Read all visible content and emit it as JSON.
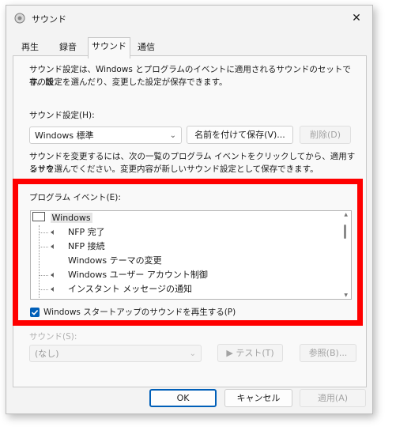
{
  "window": {
    "title": "サウンド",
    "close_symbol": "✕"
  },
  "tabs": [
    {
      "label": "再生"
    },
    {
      "label": "録音"
    },
    {
      "label": "サウンド"
    },
    {
      "label": "通信"
    }
  ],
  "intro_text_line1": "サウンド設定は、Windows とプログラムのイベントに適用されるサウンドのセットです。既",
  "intro_text_line2": "存の設定を選んだり、変更した設定が保存できます。",
  "scheme": {
    "label": "サウンド設定(H):",
    "selected": "Windows 標準",
    "save_as_label": "名前を付けて保存(V)...",
    "delete_label": "削除(D)"
  },
  "instructions_line1": "サウンドを変更するには、次の一覧のプログラム イベントをクリックしてから、適用するサウ",
  "instructions_line2": "ンドを選んでください。変更内容が新しいサウンド設定として保存できます。",
  "events": {
    "label": "プログラム イベント(E):",
    "root": "Windows",
    "items": [
      {
        "label": "NFP 完了",
        "has_sound": true
      },
      {
        "label": "NFP 接続",
        "has_sound": true
      },
      {
        "label": "Windows テーマの変更",
        "has_sound": false
      },
      {
        "label": "Windows ユーザー アカウント制御",
        "has_sound": true
      },
      {
        "label": "インスタント メッセージの通知",
        "has_sound": true
      }
    ]
  },
  "startup_checkbox": {
    "label": "Windows スタートアップのサウンドを再生する(P)",
    "checked": true
  },
  "sounds": {
    "label": "サウンド(S):",
    "selected": "(なし)",
    "test_label": "▶ テスト(T)",
    "browse_label": "参照(B)..."
  },
  "footer": {
    "ok_label": "OK",
    "cancel_label": "キャンセル",
    "apply_label": "適用(A)"
  },
  "colors": {
    "accent": "#005fb8",
    "highlight_frame": "#ff0000"
  }
}
